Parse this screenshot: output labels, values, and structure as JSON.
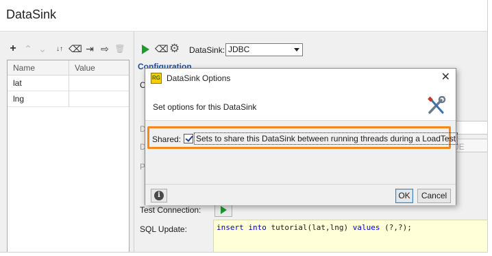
{
  "window": {
    "title": "DataSink"
  },
  "left_toolbar": {
    "buttons": [
      {
        "name": "add",
        "glyph": "+",
        "enabled": true
      },
      {
        "name": "move-up",
        "glyph": "⌃",
        "enabled": false
      },
      {
        "name": "move-down",
        "glyph": "⌄",
        "enabled": false
      },
      {
        "name": "sort",
        "glyph": "↓↑",
        "enabled": true
      },
      {
        "name": "clear",
        "glyph": "⌫",
        "enabled": true
      },
      {
        "name": "import",
        "glyph": "⇥",
        "enabled": true
      },
      {
        "name": "export",
        "glyph": "⇨",
        "enabled": true
      },
      {
        "name": "delete",
        "glyph": "🗑",
        "enabled": false
      }
    ]
  },
  "properties_table": {
    "columns": [
      "Name",
      "Value"
    ],
    "rows": [
      {
        "name": "lat",
        "value": ""
      },
      {
        "name": "lng",
        "value": ""
      }
    ]
  },
  "right_toolbar": {
    "datasink_label": "DataSink:",
    "datasink_value": "JDBC"
  },
  "config": {
    "section_label": "Configuration",
    "bg_letters": [
      "C",
      "D",
      "D",
      "P"
    ],
    "bg_value_fragment": "UE",
    "test_connection_label": "Test Connection:",
    "sql_update_label": "SQL Update:",
    "sql_update_value": "insert into tutorial(lat,lng) values (?,?);"
  },
  "dialog": {
    "title": "DataSink Options",
    "app_icon_text": "RG",
    "subtitle": "Set options for this DataSink",
    "shared_label": "Shared:",
    "shared_checked": true,
    "shared_checkbox_text": "Sets to share this DataSink between running threads during a LoadTest",
    "ok_label": "OK",
    "cancel_label": "Cancel",
    "highlight_color": "#f28a1a"
  }
}
